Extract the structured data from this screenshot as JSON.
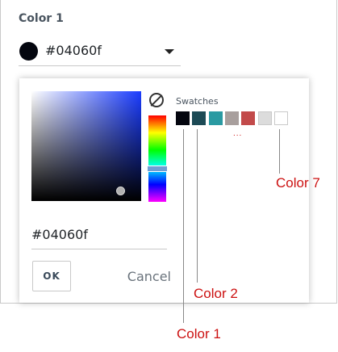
{
  "field": {
    "label": "Color 1",
    "selected_value": "#04060f",
    "selected_color": "#04060f"
  },
  "picker": {
    "base_hue_color": "#1a3cff",
    "hex_value": "#04060f",
    "no_color_icon": "no-color-icon",
    "swatches_title": "Swatches",
    "swatches": [
      {
        "color": "#04060f"
      },
      {
        "color": "#1c4a55"
      },
      {
        "color": "#2a9aa2"
      },
      {
        "color": "#a89f9d"
      },
      {
        "color": "#c24a4a"
      },
      {
        "color": "#dcdcdc"
      },
      {
        "color": "#ffffff"
      }
    ],
    "more_indicator": "...",
    "ok_label": "OK",
    "cancel_label": "Cancel"
  },
  "annotations": {
    "color_7": "Color 7",
    "color_2": "Color 2",
    "color_1": "Color 1",
    "accent": "#cc1111"
  }
}
